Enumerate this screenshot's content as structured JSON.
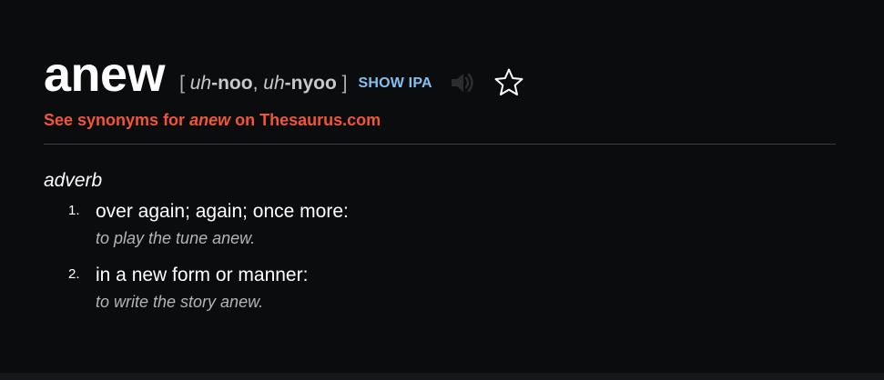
{
  "entry": {
    "headword": "anew",
    "pronunciation": {
      "open_bracket": "[",
      "syl1_ital": "uh",
      "syl1_rest": "-noo",
      "separator": ", ",
      "syl2_ital": "uh",
      "syl2_rest": "-nyoo",
      "close_bracket": "]"
    },
    "show_ipa_label": "SHOW IPA",
    "audio_icon": "speaker-icon",
    "favorite_icon": "star-icon",
    "synonyms": {
      "prefix": "See synonyms for ",
      "word": "anew",
      "suffix": " on Thesaurus.com"
    },
    "part_of_speech": "adverb",
    "definitions": [
      {
        "number": "1.",
        "text": "over again; again; once more:",
        "example": "to play the tune anew."
      },
      {
        "number": "2.",
        "text": "in a new form or manner:",
        "example": "to write the story anew."
      }
    ]
  },
  "colors": {
    "background": "#0b0c0e",
    "link_accent": "#f2553a",
    "ipa_link": "#84bfee",
    "divider": "#3d3e42"
  }
}
